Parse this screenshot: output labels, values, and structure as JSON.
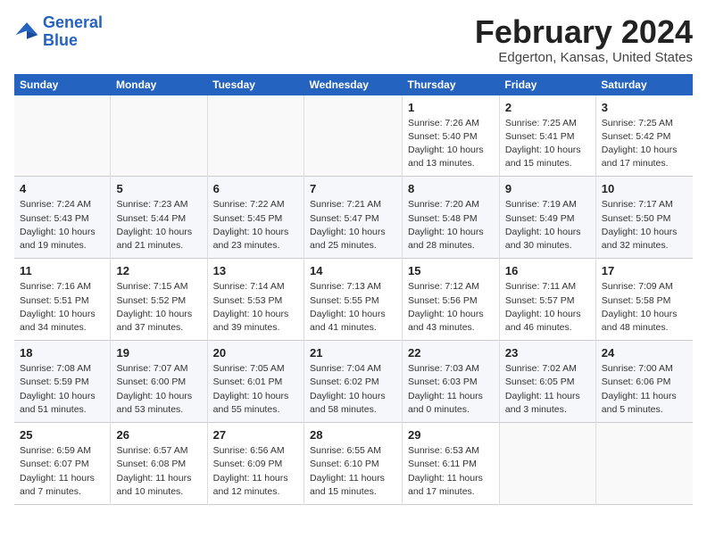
{
  "logo": {
    "line1": "General",
    "line2": "Blue"
  },
  "title": "February 2024",
  "subtitle": "Edgerton, Kansas, United States",
  "weekdays": [
    "Sunday",
    "Monday",
    "Tuesday",
    "Wednesday",
    "Thursday",
    "Friday",
    "Saturday"
  ],
  "weeks": [
    [
      {
        "day": "",
        "detail": ""
      },
      {
        "day": "",
        "detail": ""
      },
      {
        "day": "",
        "detail": ""
      },
      {
        "day": "",
        "detail": ""
      },
      {
        "day": "1",
        "detail": "Sunrise: 7:26 AM\nSunset: 5:40 PM\nDaylight: 10 hours\nand 13 minutes."
      },
      {
        "day": "2",
        "detail": "Sunrise: 7:25 AM\nSunset: 5:41 PM\nDaylight: 10 hours\nand 15 minutes."
      },
      {
        "day": "3",
        "detail": "Sunrise: 7:25 AM\nSunset: 5:42 PM\nDaylight: 10 hours\nand 17 minutes."
      }
    ],
    [
      {
        "day": "4",
        "detail": "Sunrise: 7:24 AM\nSunset: 5:43 PM\nDaylight: 10 hours\nand 19 minutes."
      },
      {
        "day": "5",
        "detail": "Sunrise: 7:23 AM\nSunset: 5:44 PM\nDaylight: 10 hours\nand 21 minutes."
      },
      {
        "day": "6",
        "detail": "Sunrise: 7:22 AM\nSunset: 5:45 PM\nDaylight: 10 hours\nand 23 minutes."
      },
      {
        "day": "7",
        "detail": "Sunrise: 7:21 AM\nSunset: 5:47 PM\nDaylight: 10 hours\nand 25 minutes."
      },
      {
        "day": "8",
        "detail": "Sunrise: 7:20 AM\nSunset: 5:48 PM\nDaylight: 10 hours\nand 28 minutes."
      },
      {
        "day": "9",
        "detail": "Sunrise: 7:19 AM\nSunset: 5:49 PM\nDaylight: 10 hours\nand 30 minutes."
      },
      {
        "day": "10",
        "detail": "Sunrise: 7:17 AM\nSunset: 5:50 PM\nDaylight: 10 hours\nand 32 minutes."
      }
    ],
    [
      {
        "day": "11",
        "detail": "Sunrise: 7:16 AM\nSunset: 5:51 PM\nDaylight: 10 hours\nand 34 minutes."
      },
      {
        "day": "12",
        "detail": "Sunrise: 7:15 AM\nSunset: 5:52 PM\nDaylight: 10 hours\nand 37 minutes."
      },
      {
        "day": "13",
        "detail": "Sunrise: 7:14 AM\nSunset: 5:53 PM\nDaylight: 10 hours\nand 39 minutes."
      },
      {
        "day": "14",
        "detail": "Sunrise: 7:13 AM\nSunset: 5:55 PM\nDaylight: 10 hours\nand 41 minutes."
      },
      {
        "day": "15",
        "detail": "Sunrise: 7:12 AM\nSunset: 5:56 PM\nDaylight: 10 hours\nand 43 minutes."
      },
      {
        "day": "16",
        "detail": "Sunrise: 7:11 AM\nSunset: 5:57 PM\nDaylight: 10 hours\nand 46 minutes."
      },
      {
        "day": "17",
        "detail": "Sunrise: 7:09 AM\nSunset: 5:58 PM\nDaylight: 10 hours\nand 48 minutes."
      }
    ],
    [
      {
        "day": "18",
        "detail": "Sunrise: 7:08 AM\nSunset: 5:59 PM\nDaylight: 10 hours\nand 51 minutes."
      },
      {
        "day": "19",
        "detail": "Sunrise: 7:07 AM\nSunset: 6:00 PM\nDaylight: 10 hours\nand 53 minutes."
      },
      {
        "day": "20",
        "detail": "Sunrise: 7:05 AM\nSunset: 6:01 PM\nDaylight: 10 hours\nand 55 minutes."
      },
      {
        "day": "21",
        "detail": "Sunrise: 7:04 AM\nSunset: 6:02 PM\nDaylight: 10 hours\nand 58 minutes."
      },
      {
        "day": "22",
        "detail": "Sunrise: 7:03 AM\nSunset: 6:03 PM\nDaylight: 11 hours\nand 0 minutes."
      },
      {
        "day": "23",
        "detail": "Sunrise: 7:02 AM\nSunset: 6:05 PM\nDaylight: 11 hours\nand 3 minutes."
      },
      {
        "day": "24",
        "detail": "Sunrise: 7:00 AM\nSunset: 6:06 PM\nDaylight: 11 hours\nand 5 minutes."
      }
    ],
    [
      {
        "day": "25",
        "detail": "Sunrise: 6:59 AM\nSunset: 6:07 PM\nDaylight: 11 hours\nand 7 minutes."
      },
      {
        "day": "26",
        "detail": "Sunrise: 6:57 AM\nSunset: 6:08 PM\nDaylight: 11 hours\nand 10 minutes."
      },
      {
        "day": "27",
        "detail": "Sunrise: 6:56 AM\nSunset: 6:09 PM\nDaylight: 11 hours\nand 12 minutes."
      },
      {
        "day": "28",
        "detail": "Sunrise: 6:55 AM\nSunset: 6:10 PM\nDaylight: 11 hours\nand 15 minutes."
      },
      {
        "day": "29",
        "detail": "Sunrise: 6:53 AM\nSunset: 6:11 PM\nDaylight: 11 hours\nand 17 minutes."
      },
      {
        "day": "",
        "detail": ""
      },
      {
        "day": "",
        "detail": ""
      }
    ]
  ]
}
